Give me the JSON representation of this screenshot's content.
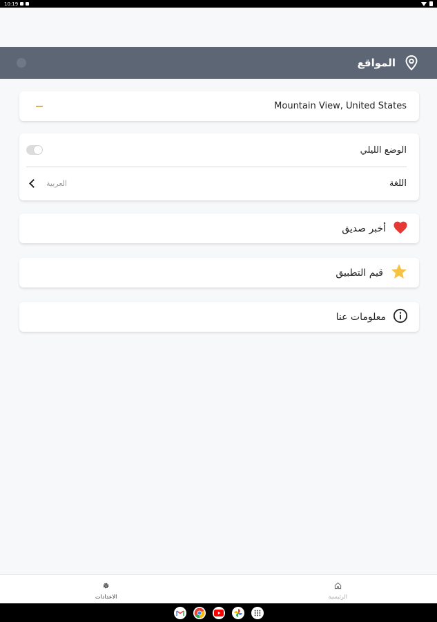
{
  "status_bar": {
    "time": "10:19"
  },
  "app_bar": {
    "title": "المواقع",
    "icon": "map-pin-icon"
  },
  "location_card": {
    "location": "Mountain View, United States"
  },
  "settings": {
    "night_mode_label": "الوضع الليلي",
    "night_mode_on": false,
    "language_label": "اللغة",
    "language_value": "العربية"
  },
  "actions": [
    {
      "label": "أخبر صديق",
      "icon": "heart-icon",
      "color": "#e53935"
    },
    {
      "label": "قيم التطبيق",
      "icon": "star-icon",
      "color": "#f5c242"
    },
    {
      "label": "معلومات عنا",
      "icon": "info-icon",
      "color": "#222222"
    }
  ],
  "bottom_nav": {
    "home_label": "الرئيسية",
    "settings_label": "الاعدادات"
  },
  "taskbar": [
    "gmail-icon",
    "chrome-icon",
    "youtube-icon",
    "photos-icon",
    "app-drawer-icon"
  ]
}
